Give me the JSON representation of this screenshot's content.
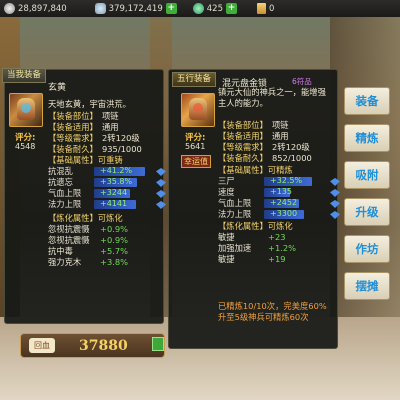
{
  "topbar": {
    "silver": "28,897,840",
    "silver_icon": "silver-coin-icon",
    "gold": "379,172,419",
    "gold_icon": "gold-ingot-icon",
    "jade": "425",
    "jade_icon": "jade-icon",
    "ticket": "0",
    "ticket_icon": "ticket-icon"
  },
  "left_item": {
    "tag": "当我装备",
    "name": "玄黄",
    "score_label": "评分:",
    "score": "4548",
    "desc": "天地玄黄，宇宙洪荒。",
    "lines": [
      {
        "label": "【装备部位】",
        "value": "项链"
      },
      {
        "label": "【装备适用】",
        "value": "通用"
      },
      {
        "label": "【等级需求】",
        "value": "2转120级"
      },
      {
        "label": "【装备耐久】",
        "value": "935/1000"
      }
    ],
    "base_header": "【基础属性】可重铸",
    "base": [
      {
        "name": "抗混乱",
        "value": "+41.2%",
        "fill": 0.85
      },
      {
        "name": "抗遗忘",
        "value": "+35.8%",
        "fill": 0.72
      },
      {
        "name": "气血上限",
        "value": "+3244",
        "fill": 0.6
      },
      {
        "name": "法力上限",
        "value": "+4141",
        "fill": 0.7
      }
    ],
    "refine_header": "【炼化属性】可炼化",
    "refine": [
      {
        "name": "忽视抗震慑",
        "value": "+0.9%"
      },
      {
        "name": "忽视抗震慑",
        "value": "+0.9%"
      },
      {
        "name": "抗中毒",
        "value": "+5.7%"
      },
      {
        "name": "强力克木",
        "value": "+3.8%"
      }
    ]
  },
  "right_item": {
    "tag": "五行装备",
    "name": "混元盘金锁",
    "rare": "6符品",
    "score_label": "评分:",
    "score": "5641",
    "lucky": "幸运值",
    "desc": "镇元大仙的神兵之一，能增强主人的能力。",
    "lines": [
      {
        "label": "【装备部位】",
        "value": "项链"
      },
      {
        "label": "【装备适用】",
        "value": "通用"
      },
      {
        "label": "【等级需求】",
        "value": "2转120级"
      },
      {
        "label": "【装备耐久】",
        "value": "852/1000"
      }
    ],
    "base_header": "【基础属性】可精炼",
    "base": [
      {
        "name": "三尸",
        "value": "+32.5%",
        "fill": 0.75
      },
      {
        "name": "速度",
        "value": "+135",
        "fill": 0.4
      },
      {
        "name": "气血上限",
        "value": "+2452",
        "fill": 0.55
      },
      {
        "name": "法力上限",
        "value": "+3300",
        "fill": 0.62
      }
    ],
    "refine_header": "【炼化属性】可炼化",
    "refine": [
      {
        "name": "敏捷",
        "value": "+23"
      },
      {
        "name": "加强加速",
        "value": "+1.2%"
      },
      {
        "name": "敏捷",
        "value": "+19"
      }
    ],
    "note1": "已精炼10/10次，完美度60%",
    "note2": "升至5级神兵可精炼60次"
  },
  "buttons": [
    "装备",
    "精炼",
    "吸附",
    "升级",
    "作坊",
    "摆摊"
  ],
  "bottom": {
    "label": "回血",
    "power": "37880"
  }
}
